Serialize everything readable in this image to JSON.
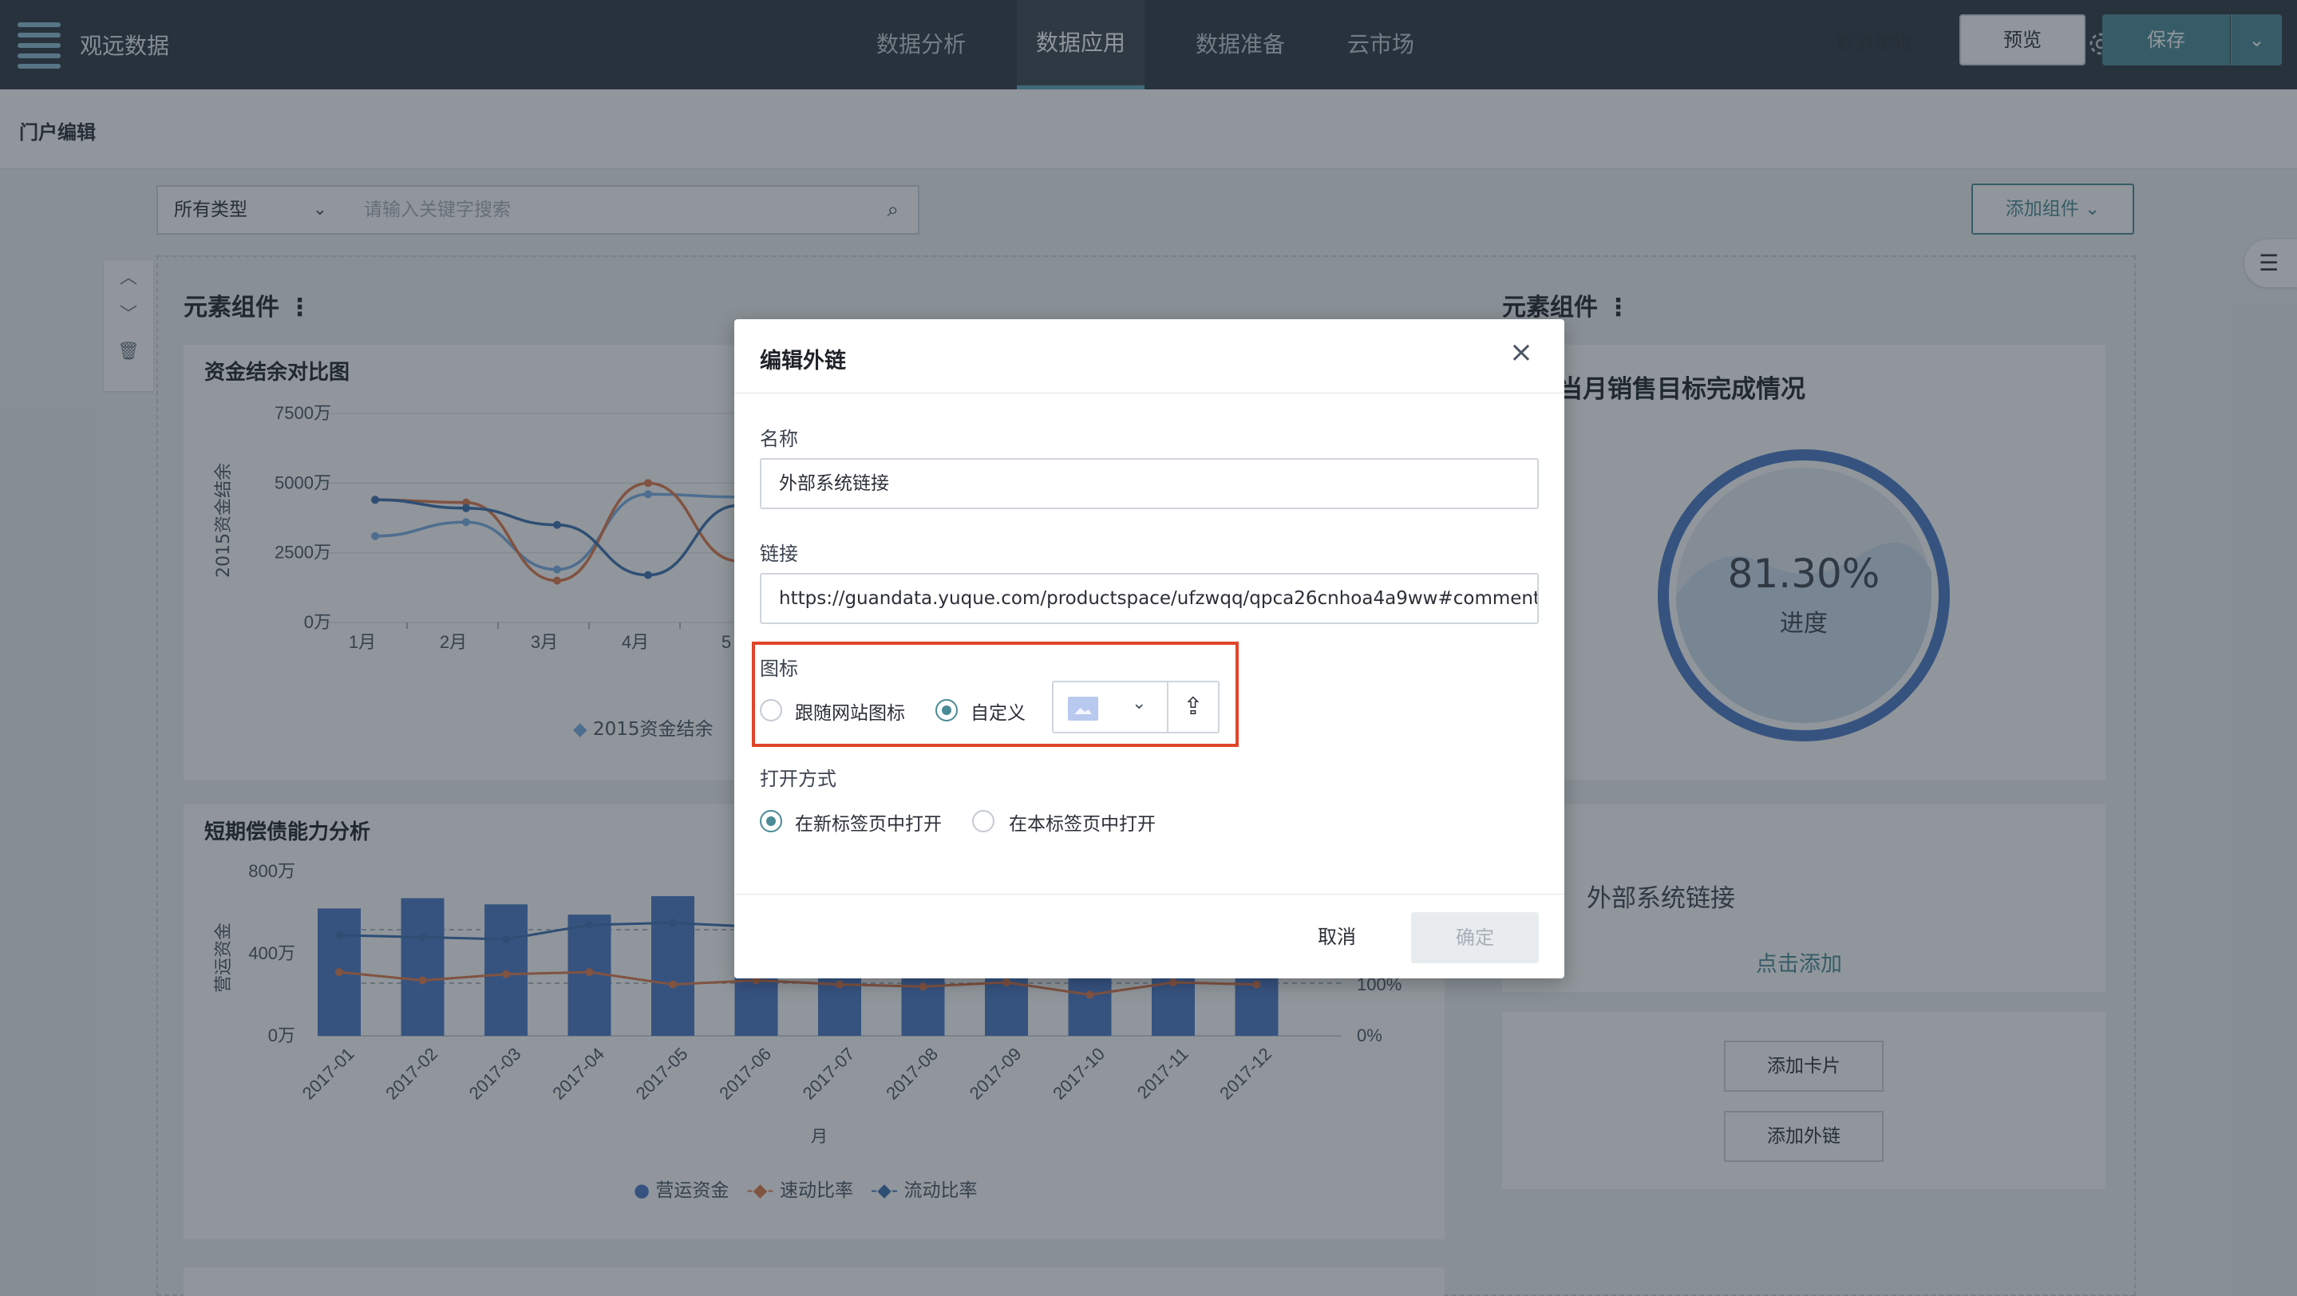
{
  "app": {
    "name": "观远数据"
  },
  "nav": {
    "tabs": [
      "数据分析",
      "数据应用",
      "数据准备",
      "云市场"
    ],
    "active_index": 1
  },
  "top_icons": [
    "help-icon",
    "download-icon",
    "settings-icon",
    "search-icon",
    "apps-grid-icon",
    "avatar"
  ],
  "editbar": {
    "title": "门户编辑",
    "cancel_edit": "取消编辑",
    "preview": "预览",
    "save": "保存"
  },
  "toolbar": {
    "type_select": "所有类型",
    "search_placeholder": "请输入关键字搜索",
    "add_component": "添加组件"
  },
  "sections": {
    "left_title": "元素组件",
    "right_title": "元素组件"
  },
  "chart_data": [
    {
      "type": "line",
      "title": "资金结余对比图",
      "ylabel": "2015资金结余",
      "y_ticks": [
        "7500万",
        "5000万",
        "2500万",
        "0万"
      ],
      "ylim": [
        0,
        7500
      ],
      "categories": [
        "1月",
        "2月",
        "3月",
        "4月",
        "5"
      ],
      "series": [
        {
          "name": "2015资金结余",
          "color": "#7aaee6",
          "values": [
            3100,
            3600,
            1900,
            4600,
            4500
          ]
        },
        {
          "color": "#e0784a",
          "values": [
            4400,
            4300,
            1500,
            5000,
            2200
          ]
        },
        {
          "color": "#3b6fb0",
          "values": [
            4400,
            4100,
            3500,
            1700,
            4200
          ]
        }
      ]
    },
    {
      "type": "bar",
      "title": "短期偿债能力分析",
      "ylabel": "营运资金",
      "xlabel": "月",
      "y_ticks": [
        "800万",
        "400万",
        "0万"
      ],
      "y2_ticks": [
        "100%",
        "0%"
      ],
      "ylim": [
        0,
        800
      ],
      "categories": [
        "2017-01",
        "2017-02",
        "2017-03",
        "2017-04",
        "2017-05",
        "2017-06",
        "2017-07",
        "2017-08",
        "2017-09",
        "2017-10",
        "2017-11",
        "2017-12"
      ],
      "series": [
        {
          "name": "营运资金",
          "color": "#4a78c8",
          "values": [
            620,
            670,
            640,
            590,
            680,
            560,
            540,
            520,
            500,
            510,
            600,
            540
          ]
        },
        {
          "name": "速动比率",
          "color": "#e0784a",
          "values": [
            310,
            270,
            300,
            310,
            250,
            270,
            250,
            240,
            260,
            200,
            260,
            250
          ]
        },
        {
          "name": "流动比率",
          "color": "#3b6fb0",
          "values": [
            490,
            480,
            470,
            540,
            550,
            530,
            520,
            510,
            500,
            500,
            490,
            500
          ]
        }
      ]
    }
  ],
  "gauge": {
    "title": "当月销售目标完成情况",
    "percent_text": "81.30%",
    "label": "进度",
    "value": 0.813
  },
  "right_panel": {
    "link_name": "外部系统链接",
    "click_add": "点击添加",
    "add_card": "添加卡片",
    "add_link": "添加外链"
  },
  "modal": {
    "title": "编辑外链",
    "name_label": "名称",
    "name_value": "外部系统链接",
    "link_label": "链接",
    "link_value": "https://guandata.yuque.com/productspace/ufzwqq/qpca26cnhoa4a9ww#comment",
    "icon_label": "图标",
    "icon_options": [
      "跟随网站图标",
      "自定义"
    ],
    "icon_selected": 1,
    "open_label": "打开方式",
    "open_options": [
      "在新标签页中打开",
      "在本标签页中打开"
    ],
    "open_selected": 0,
    "cancel": "取消",
    "ok": "确定"
  },
  "colors": {
    "accent": "#4a8b96",
    "highlight": "#e0452a",
    "nav_bg": "#2f3742"
  }
}
